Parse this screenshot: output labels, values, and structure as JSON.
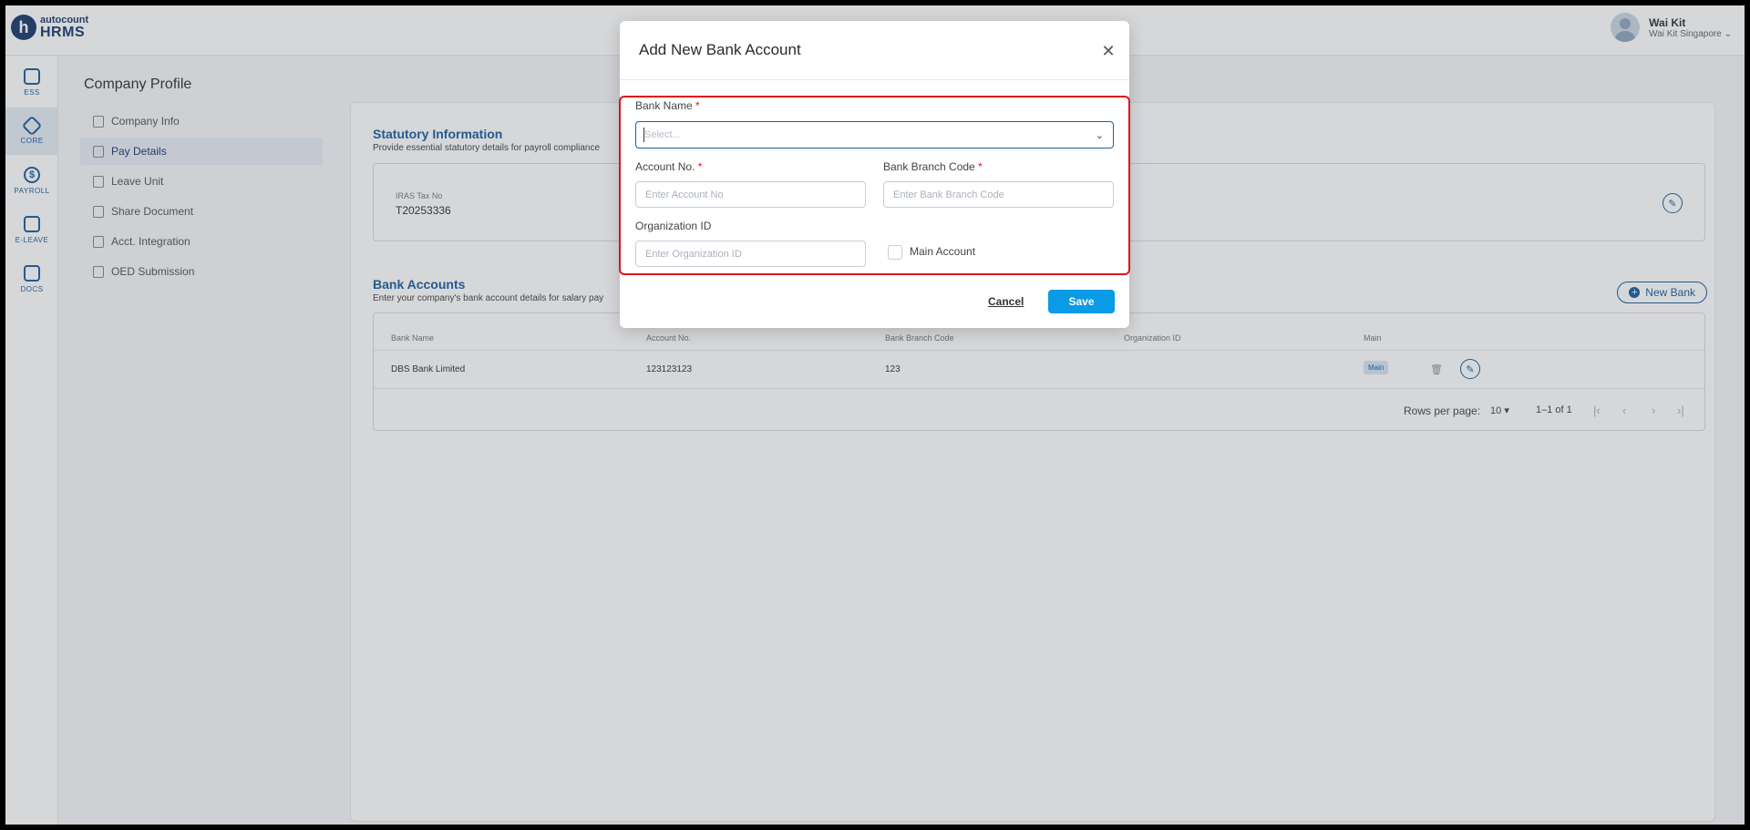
{
  "app": {
    "logo_brand": "autocount",
    "logo_product": "HRMS",
    "logo_mark": "h"
  },
  "user": {
    "name": "Wai Kit",
    "company": "Wai Kit Singapore"
  },
  "rail": [
    {
      "label": "ESS",
      "icon": "ess-icon"
    },
    {
      "label": "CORE",
      "icon": "core-icon",
      "active": true
    },
    {
      "label": "PAYROLL",
      "icon": "dollar-icon"
    },
    {
      "label": "E-LEAVE",
      "icon": "calendar-icon"
    },
    {
      "label": "DOCS",
      "icon": "chart-icon"
    }
  ],
  "page": {
    "title": "Company Profile"
  },
  "subnav": [
    {
      "label": "Company Info"
    },
    {
      "label": "Pay Details",
      "active": true
    },
    {
      "label": "Leave Unit"
    },
    {
      "label": "Share Document"
    },
    {
      "label": "Acct. Integration"
    },
    {
      "label": "OED Submission"
    }
  ],
  "statutory": {
    "title": "Statutory Information",
    "subtitle": "Provide essential statutory details for payroll compliance",
    "field_label": "IRAS Tax No",
    "field_value": "T20253336"
  },
  "bank_accounts": {
    "title": "Bank Accounts",
    "subtitle": "Enter your company's bank account details for salary pay",
    "new_bank_label": "New Bank",
    "columns": [
      "Bank Name",
      "Account No.",
      "Bank Branch Code",
      "Organization ID",
      "Main"
    ],
    "rows": [
      {
        "bank_name": "DBS Bank Limited",
        "account_no": "123123123",
        "branch_code": "123",
        "organization_id": "",
        "main": "Main"
      }
    ],
    "pager": {
      "rows_per_page_label": "Rows per page:",
      "rows_per_page_value": "10",
      "range": "1–1 of 1"
    }
  },
  "modal": {
    "title": "Add New Bank Account",
    "bank_name_label": "Bank Name",
    "bank_name_placeholder": "Select...",
    "account_no_label": "Account No.",
    "account_no_placeholder": "Enter Account No",
    "branch_code_label": "Bank Branch Code",
    "branch_code_placeholder": "Enter Bank Branch Code",
    "org_id_label": "Organization ID",
    "org_id_placeholder": "Enter Organization ID",
    "main_account_label": "Main Account",
    "required_marker": "*",
    "cancel_label": "Cancel",
    "save_label": "Save"
  },
  "colors": {
    "primary": "#1b5fa1",
    "accent": "#0a9be6",
    "highlight": "#e0141e"
  }
}
